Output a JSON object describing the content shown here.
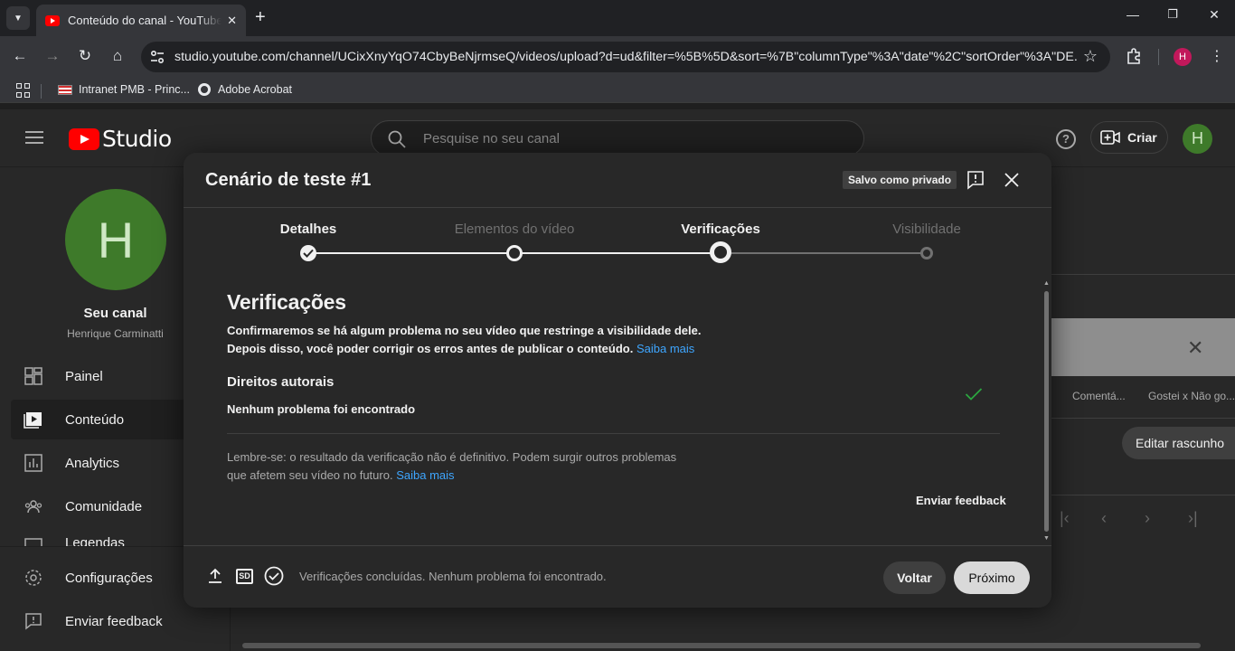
{
  "browser": {
    "tab_title": "Conteúdo do canal - YouTube Studio",
    "url_host": "studio.youtube.com",
    "url_path": "/channel/UCixXnyYqO74CbyBeNjrmseQ/videos/upload?d=ud&filter=%5B%5D&sort=%7B\"columnType\"%3A\"date\"%2C\"sortOrder\"%3A\"DE...",
    "profile_initial": "H",
    "bookmarks": [
      {
        "label": "Intranet PMB - Princ...",
        "icon": "flag-icon"
      },
      {
        "label": "Adobe Acrobat",
        "icon": "globe-icon"
      }
    ]
  },
  "studio": {
    "logo_text": "Studio",
    "search_placeholder": "Pesquise no seu canal",
    "create_label": "Criar",
    "avatar_initial": "H"
  },
  "sidebar": {
    "avatar_initial": "H",
    "channel_label": "Seu canal",
    "channel_name": "Henrique Carminatti",
    "items": [
      {
        "label": "Painel",
        "icon": "dashboard-icon",
        "active": false
      },
      {
        "label": "Conteúdo",
        "icon": "content-icon",
        "active": true
      },
      {
        "label": "Analytics",
        "icon": "analytics-icon",
        "active": false
      },
      {
        "label": "Comunidade",
        "icon": "community-icon",
        "active": false
      },
      {
        "label": "Legendas",
        "icon": "subtitles-icon",
        "active": false
      },
      {
        "label": "Configurações",
        "icon": "settings-icon",
        "active": false
      },
      {
        "label": "Enviar feedback",
        "icon": "feedback-icon",
        "active": false
      }
    ]
  },
  "background": {
    "columns": [
      "Comentá...",
      "Gostei x Não go..."
    ],
    "edit_draft": "Editar rascunho"
  },
  "dialog": {
    "title": "Cenário de teste #1",
    "saved_badge": "Salvo como privado",
    "steps": [
      {
        "label": "Detalhes",
        "state": "done"
      },
      {
        "label": "Elementos do vídeo",
        "state": "done"
      },
      {
        "label": "Verificações",
        "state": "current"
      },
      {
        "label": "Visibilidade",
        "state": "todo"
      }
    ],
    "section_title": "Verificações",
    "section_desc": "Confirmaremos se há algum problema no seu vídeo que restringe a visibilidade dele. Depois disso, você poder corrigir os erros antes de publicar o conteúdo.",
    "learn_more": "Saiba mais",
    "copyright_title": "Direitos autorais",
    "copyright_status": "Nenhum problema foi encontrado",
    "reminder": "Lembre-se: o resultado da verificação não é definitivo. Podem surgir outros problemas que afetem seu vídeo no futuro.",
    "reminder_link": "Saiba mais",
    "feedback": "Enviar feedback",
    "footer_quality": "SD",
    "footer_status": "Verificações concluídas. Nenhum problema foi encontrado.",
    "back_label": "Voltar",
    "next_label": "Próximo"
  },
  "colors": {
    "accent_link": "#3ea6ff",
    "check_green": "#2ba640",
    "brand_red": "#ff0000"
  }
}
